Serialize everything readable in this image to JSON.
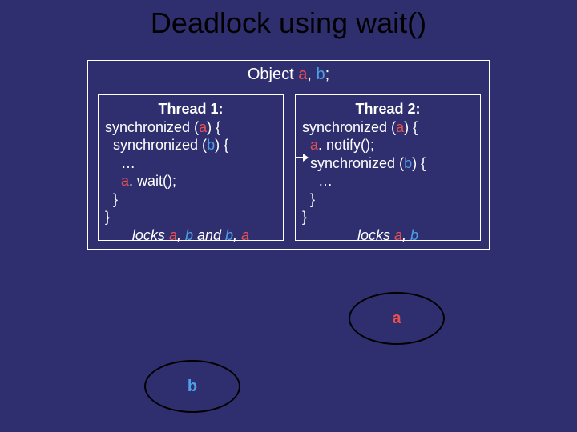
{
  "title": "Deadlock using wait()",
  "object_decl": {
    "prefix": "Object ",
    "a": "a",
    "sep1": ", ",
    "b": "b",
    "suffix": ";"
  },
  "thread1": {
    "heading": "Thread 1:",
    "l1a": "synchronized (",
    "l1b": "a",
    "l1c": ") {",
    "l2a": "  synchronized (",
    "l2b": "b",
    "l2c": ") {",
    "l3": "    …",
    "l4a": "    ",
    "l4b": "a",
    "l4c": ". wait();",
    "l5": "  }",
    "l6": "}",
    "locks_pre": "locks ",
    "locks_a1": "a",
    "locks_s1": ", ",
    "locks_b1": "b",
    "locks_and": " and ",
    "locks_b2": "b",
    "locks_s2": ", ",
    "locks_a2": "a"
  },
  "thread2": {
    "heading": "Thread 2:",
    "l1a": "synchronized (",
    "l1b": "a",
    "l1c": ") {",
    "l2a": "  ",
    "l2b": "a",
    "l2c": ". notify();",
    "l3a": "  synchronized (",
    "l3b": "b",
    "l3c": ") {",
    "l4": "    …",
    "l5": "  }",
    "l6": "}",
    "locks_pre": "locks ",
    "locks_a": "a",
    "locks_s": ", ",
    "locks_b": "b"
  },
  "ellipse_a": "a",
  "ellipse_b": "b"
}
